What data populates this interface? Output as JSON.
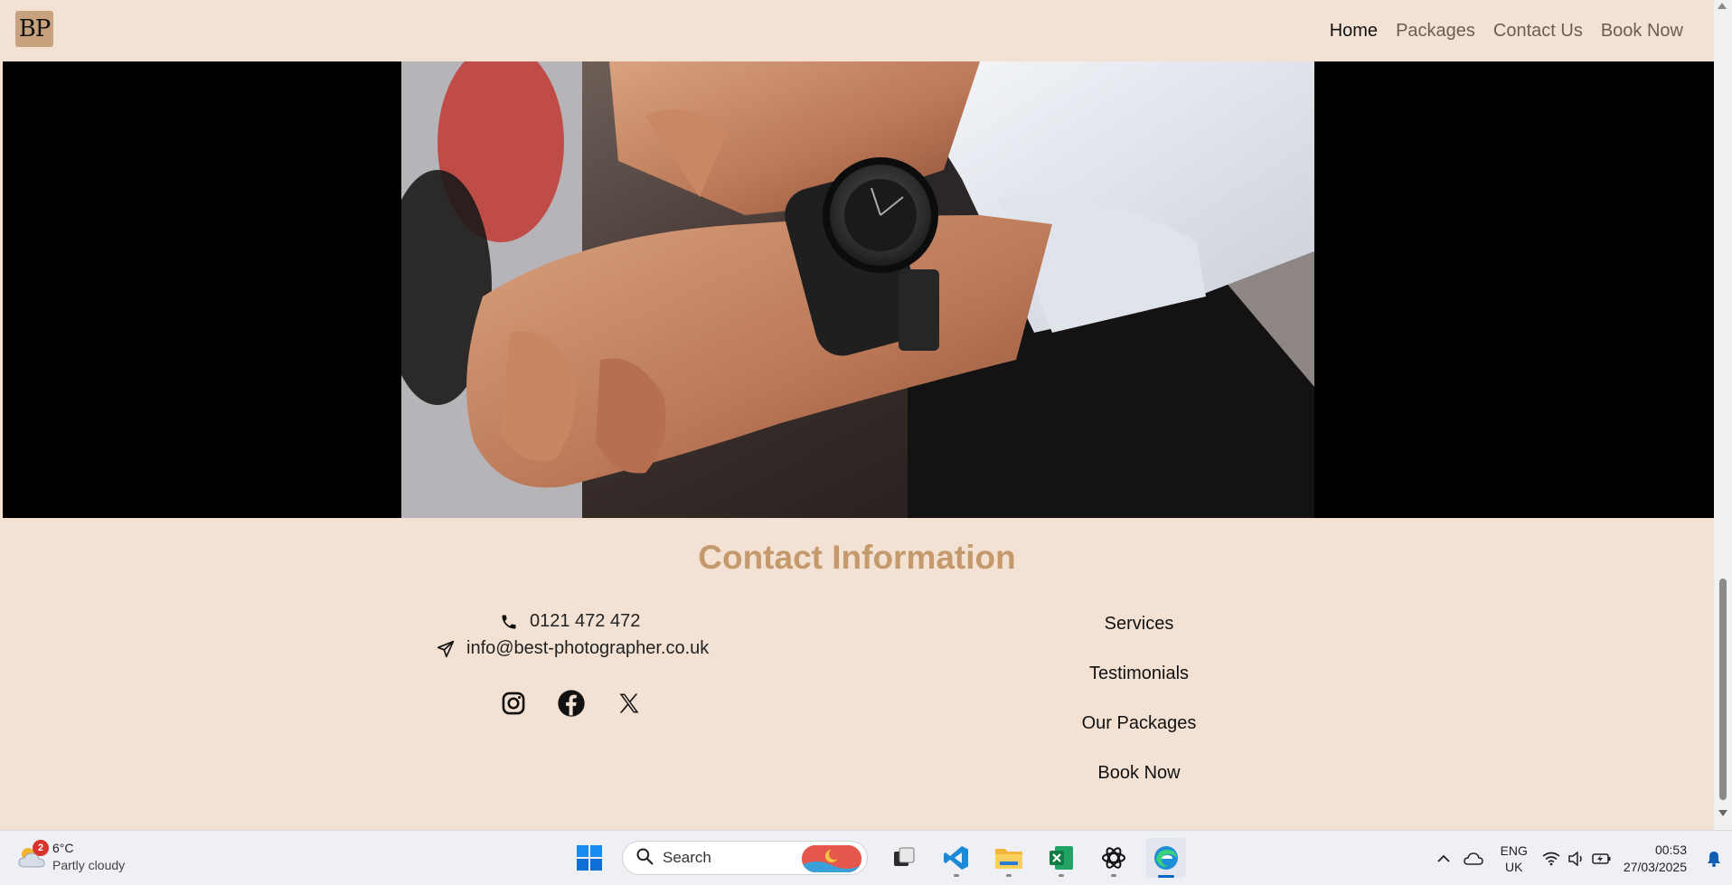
{
  "navbar": {
    "logo_text": "BP",
    "links": [
      {
        "label": "Home",
        "active": true
      },
      {
        "label": "Packages",
        "active": false
      },
      {
        "label": "Contact Us",
        "active": false
      },
      {
        "label": "Book Now",
        "active": false
      }
    ]
  },
  "hero": {
    "image_icon": "photo-of-man-adjusting-wristwatch"
  },
  "contact": {
    "title": "Contact Information",
    "phone": "0121 472 472",
    "email": "info@best-photographer.co.uk",
    "socials": [
      "instagram-icon",
      "facebook-icon",
      "x-icon"
    ]
  },
  "footer_links": [
    "Services",
    "Testimonials",
    "Our Packages",
    "Book Now"
  ],
  "taskbar": {
    "weather": {
      "badge": "2",
      "temp": "6°C",
      "condition": "Partly cloudy"
    },
    "search_placeholder": "Search",
    "apps": [
      "start-icon",
      "task-view-icon",
      "vscode-icon",
      "file-explorer-icon",
      "excel-icon",
      "chatgpt-icon",
      "edge-icon"
    ],
    "language": {
      "line1": "ENG",
      "line2": "UK"
    },
    "time": "00:53",
    "date": "27/03/2025"
  },
  "colors": {
    "page_bg": "#f3e2d4",
    "accent": "#c49a6c",
    "logo_bg": "#c8a27f"
  }
}
